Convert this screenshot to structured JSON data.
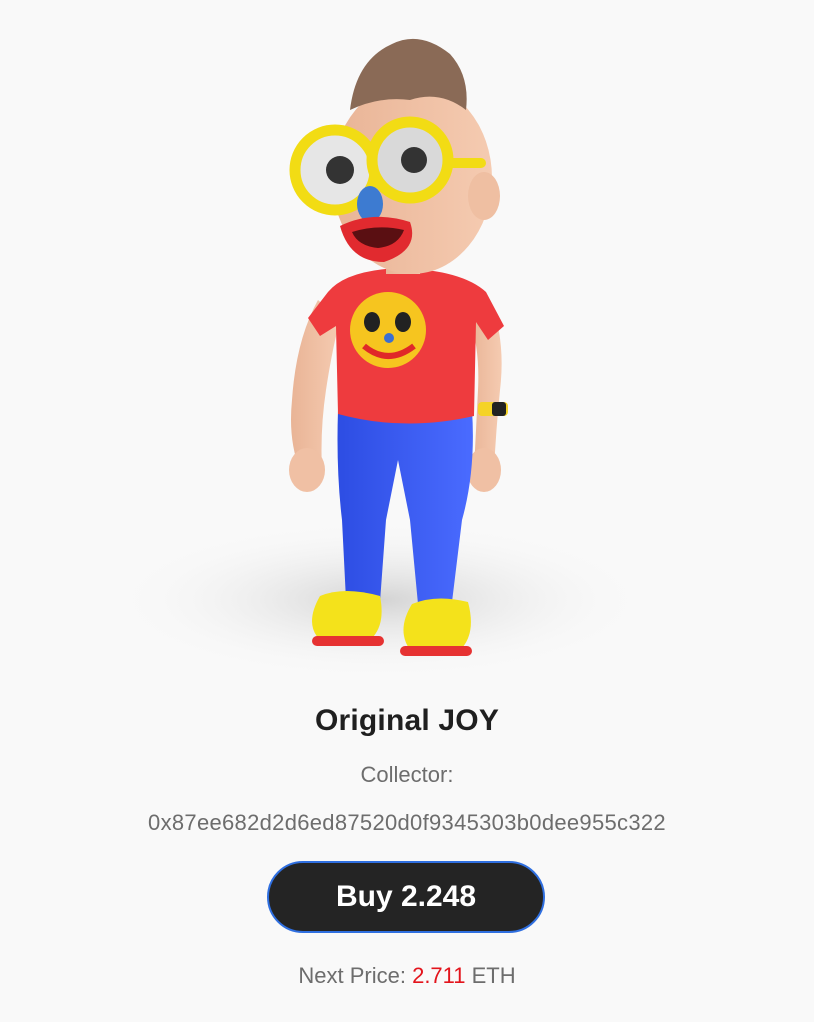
{
  "item": {
    "title": "Original JOY",
    "image_alt": "3D character figure with yellow glasses, red shirt and blue pants"
  },
  "collector": {
    "label": "Collector:",
    "address": "0x87ee682d2d6ed87520d0f9345303b0dee955c322"
  },
  "buy": {
    "label": "Buy 2.248"
  },
  "next_price": {
    "label": "Next Price:",
    "value": "2.711",
    "unit": "ETH"
  },
  "colors": {
    "background": "#f9f9f9",
    "button_bg": "#242424",
    "button_border": "#2f6fe0",
    "price_accent": "#e3141c",
    "muted_text": "#6d6d6d"
  }
}
